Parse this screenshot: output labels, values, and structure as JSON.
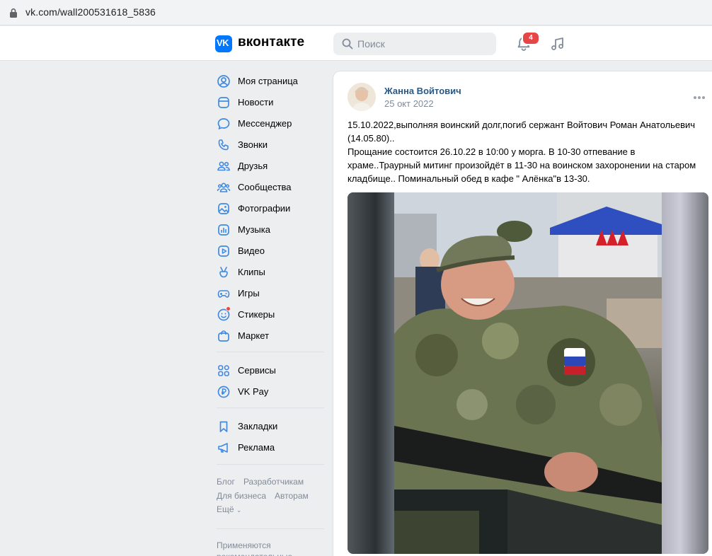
{
  "browser": {
    "url": "vk.com/wall200531618_5836"
  },
  "header": {
    "logo_mark": "VK",
    "logo_text": "вконтакте",
    "search_placeholder": "Поиск",
    "notifications_count": "4",
    "accent_color": "#0077ff"
  },
  "sidebar": {
    "items": [
      {
        "label": "Моя страница",
        "icon": "user-circle-icon"
      },
      {
        "label": "Новости",
        "icon": "newsfeed-icon"
      },
      {
        "label": "Мессенджер",
        "icon": "message-icon"
      },
      {
        "label": "Звонки",
        "icon": "phone-icon"
      },
      {
        "label": "Друзья",
        "icon": "friends-icon"
      },
      {
        "label": "Сообщества",
        "icon": "communities-icon"
      },
      {
        "label": "Фотографии",
        "icon": "photo-icon"
      },
      {
        "label": "Музыка",
        "icon": "music-icon"
      },
      {
        "label": "Видео",
        "icon": "video-icon"
      },
      {
        "label": "Клипы",
        "icon": "clips-icon"
      },
      {
        "label": "Игры",
        "icon": "gamepad-icon"
      },
      {
        "label": "Стикеры",
        "icon": "smile-icon"
      },
      {
        "label": "Маркет",
        "icon": "market-bag-icon"
      },
      {
        "label": "Сервисы",
        "icon": "services-grid-icon"
      },
      {
        "label": "VK Pay",
        "icon": "vkpay-icon"
      },
      {
        "label": "Закладки",
        "icon": "bookmark-icon"
      },
      {
        "label": "Реклама",
        "icon": "megaphone-icon"
      }
    ],
    "footer_links": [
      "Блог",
      "Разработчикам",
      "Для бизнеса",
      "Авторам",
      "Ещё"
    ],
    "footer_note": "Применяются рекомендательные"
  },
  "post": {
    "author": "Жанна Войтович",
    "date": "25 окт 2022",
    "text_lines": [
      "15.10.2022,выполняя воинский долг,погиб сержант Войтович Роман Анатольевич",
      "(14.05.80)..",
      "Прощание состоится 26.10.22 в 10:00 у морга. В 10-30 отпевание в",
      "храме..Траурный митинг произойдёт в 11-30 на воинском захоронении на старом",
      "кладбище.. Поминальный обед в кафе \" Алёнка\"в 13-30."
    ]
  }
}
